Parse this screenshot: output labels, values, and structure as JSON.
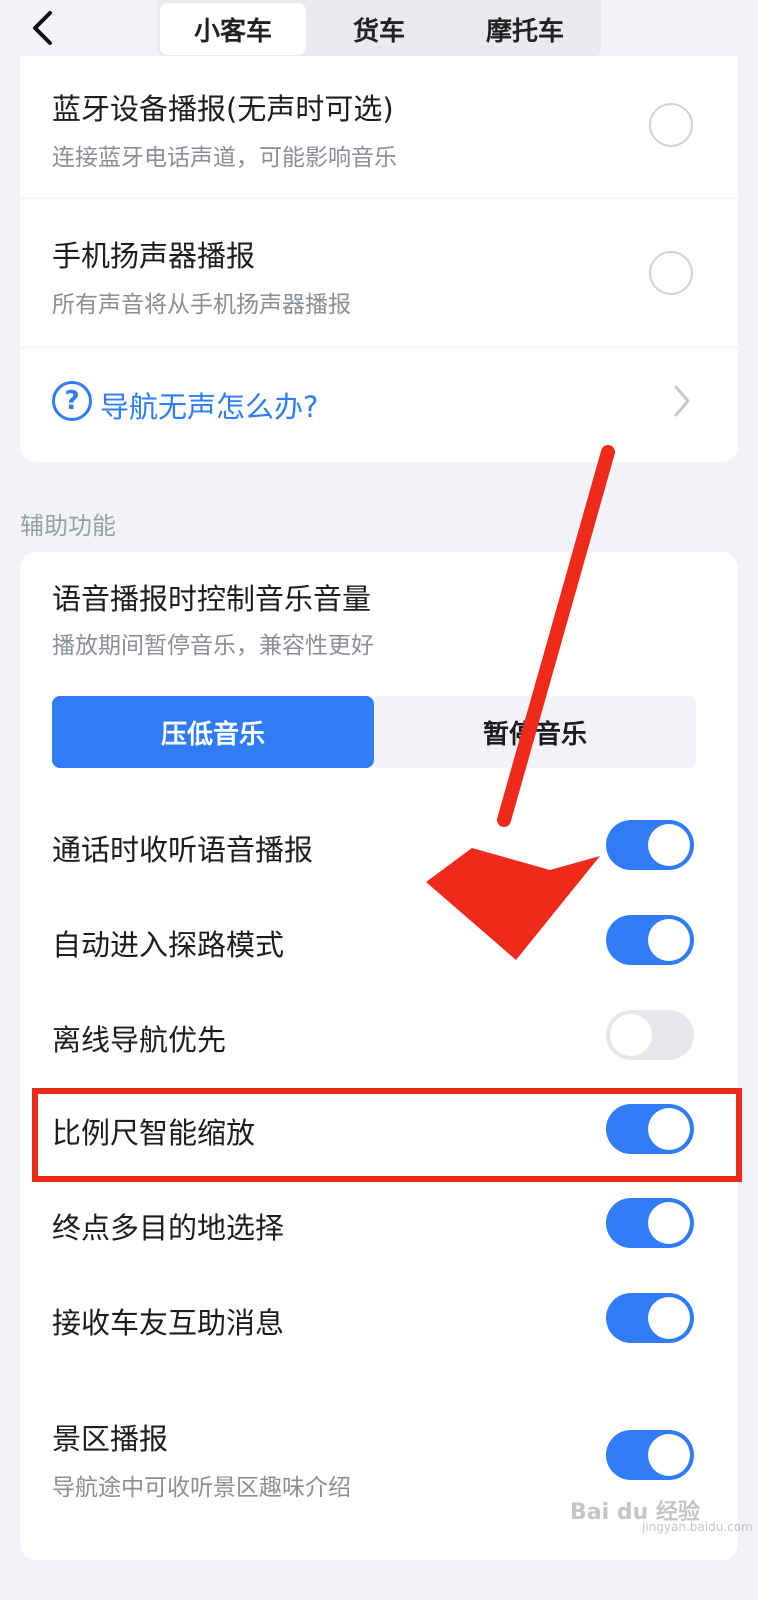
{
  "header": {
    "tabs": [
      {
        "label": "小客车",
        "active": true
      },
      {
        "label": "货车",
        "active": false
      },
      {
        "label": "摩托车",
        "active": false
      }
    ]
  },
  "voice_output": {
    "bluetooth": {
      "title": "蓝牙设备播报(无声时可选)",
      "subtitle": "连接蓝牙电话声道，可能影响音乐",
      "selected": false
    },
    "speaker": {
      "title": "手机扬声器播报",
      "subtitle": "所有声音将从手机扬声器播报",
      "selected": false
    },
    "help_link": "导航无声怎么办?"
  },
  "assist": {
    "section_label": "辅助功能",
    "music_control": {
      "title": "语音播报时控制音乐音量",
      "subtitle": "播放期间暂停音乐，兼容性更好",
      "options": [
        "压低音乐",
        "暂停音乐"
      ],
      "selected": "压低音乐"
    },
    "toggles": [
      {
        "label": "通话时收听语音播报",
        "on": true
      },
      {
        "label": "自动进入探路模式",
        "on": true
      },
      {
        "label": "离线导航优先",
        "on": false
      },
      {
        "label": "比例尺智能缩放",
        "on": true
      },
      {
        "label": "终点多目的地选择",
        "on": true
      },
      {
        "label": "接收车友互助消息",
        "on": true
      }
    ],
    "scenic": {
      "title": "景区播报",
      "subtitle": "导航途中可收听景区趣味介绍",
      "on": true
    }
  },
  "watermark": {
    "text": "Bai du 经验",
    "sub": "jingyan.baidu.com"
  },
  "colors": {
    "accent": "#2f7cf6",
    "annotation": "#ee2a1b",
    "toggle_off": "#e6e7ea"
  }
}
